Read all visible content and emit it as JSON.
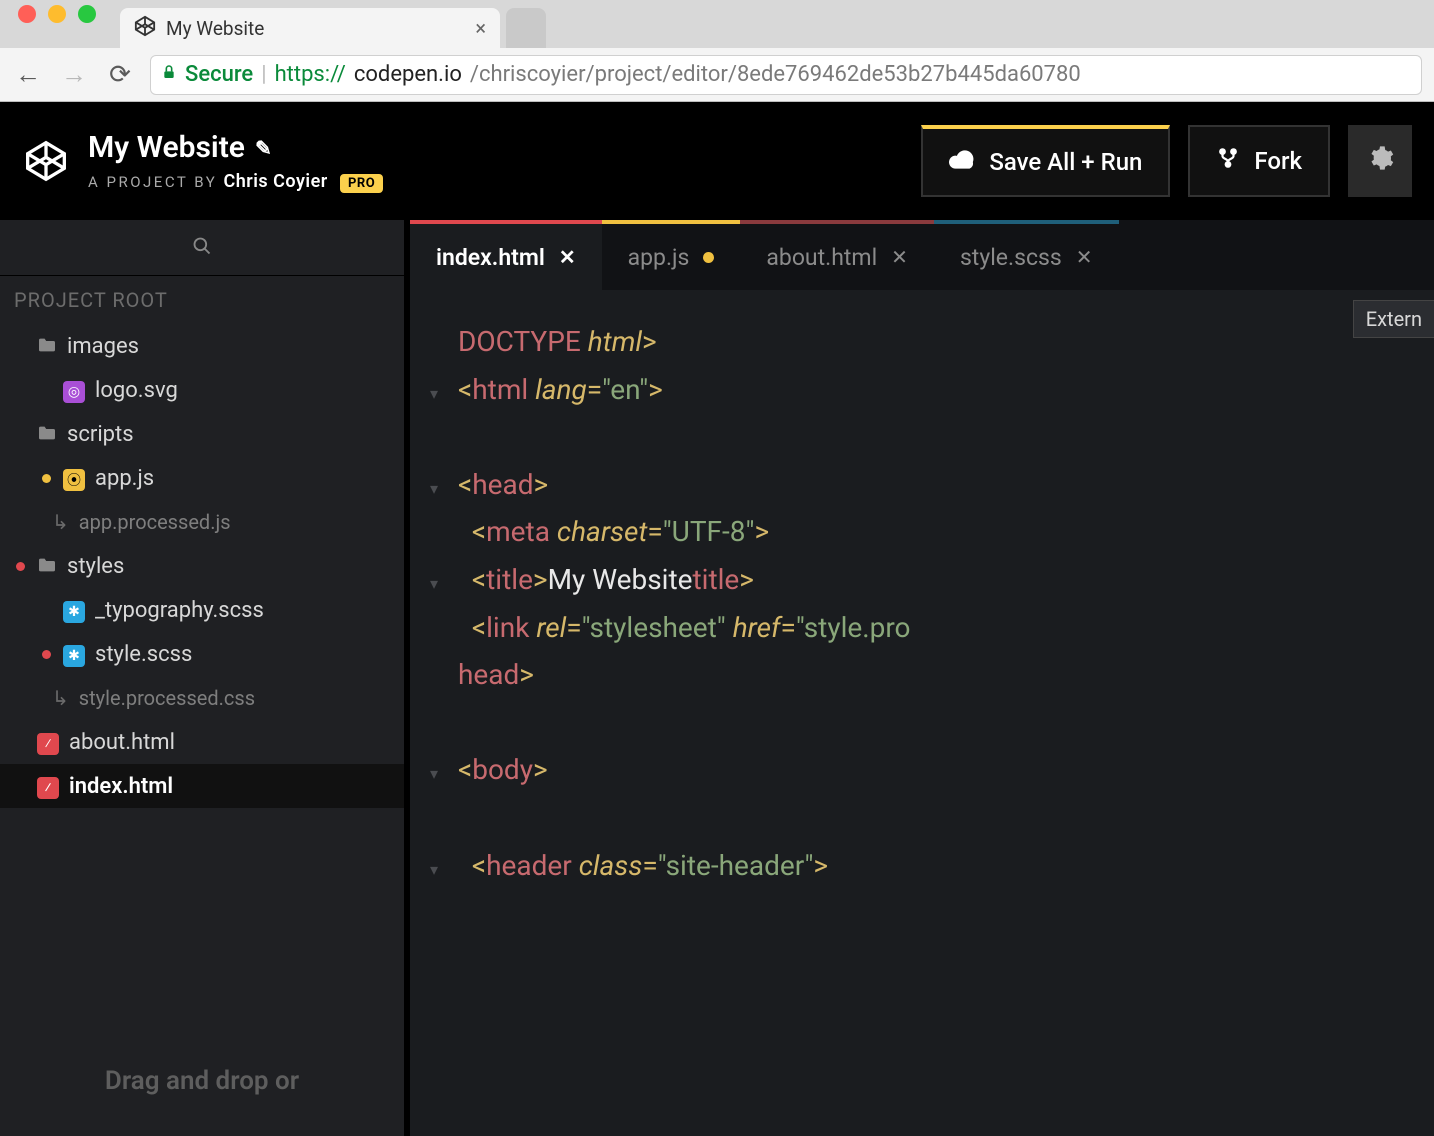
{
  "browser": {
    "tab_title": "My Website",
    "secure_label": "Secure",
    "url_proto": "https://",
    "url_host": "codepen.io",
    "url_path": "/chriscoyier/project/editor/8ede769462de53b27b445da60780"
  },
  "header": {
    "title": "My Website",
    "subtitle_prefix": "A PROJECT BY",
    "author": "Chris Coyier",
    "pro_badge": "PRO",
    "save_label": "Save All + Run",
    "fork_label": "Fork"
  },
  "sidebar": {
    "root_label": "PROJECT ROOT",
    "drop_hint": "Drag and drop or",
    "items": [
      {
        "name": "images",
        "type": "folder",
        "modified": false
      },
      {
        "name": "logo.svg",
        "type": "svg",
        "depth": 1,
        "modified": false
      },
      {
        "name": "scripts",
        "type": "folder",
        "modified": false
      },
      {
        "name": "app.js",
        "type": "js",
        "depth": 1,
        "modified": true,
        "dot": "yellow"
      },
      {
        "name": "app.processed.js",
        "type": "processed",
        "depth": 2
      },
      {
        "name": "styles",
        "type": "folder",
        "modified": true,
        "dot": "red"
      },
      {
        "name": "_typography.scss",
        "type": "scss",
        "depth": 1,
        "modified": false
      },
      {
        "name": "style.scss",
        "type": "scss",
        "depth": 1,
        "modified": true,
        "dot": "red"
      },
      {
        "name": "style.processed.css",
        "type": "processed",
        "depth": 2
      },
      {
        "name": "about.html",
        "type": "html",
        "modified": false
      },
      {
        "name": "index.html",
        "type": "html",
        "modified": false,
        "selected": true
      }
    ]
  },
  "editor_tabs": [
    {
      "label": "index.html",
      "active": true,
      "indicator": "close",
      "accent": "red"
    },
    {
      "label": "app.js",
      "active": false,
      "indicator": "dot",
      "accent": "yellow"
    },
    {
      "label": "about.html",
      "active": false,
      "indicator": "close",
      "accent": "red"
    },
    {
      "label": "style.scss",
      "active": false,
      "indicator": "close",
      "accent": "blue"
    }
  ],
  "external_button": "Extern",
  "code_lines": [
    {
      "fold": false,
      "tokens": [
        {
          "t": "bracket",
          "v": "<!"
        },
        {
          "t": "tag",
          "v": "DOCTYPE "
        },
        {
          "t": "attr",
          "v": "html"
        },
        {
          "t": "bracket",
          "v": ">"
        }
      ]
    },
    {
      "fold": true,
      "tokens": [
        {
          "t": "bracket",
          "v": "<"
        },
        {
          "t": "tag",
          "v": "html "
        },
        {
          "t": "attr",
          "v": "lang"
        },
        {
          "t": "eq",
          "v": "="
        },
        {
          "t": "str",
          "v": "\"en\""
        },
        {
          "t": "bracket",
          "v": ">"
        }
      ]
    },
    {
      "fold": false,
      "tokens": []
    },
    {
      "fold": true,
      "tokens": [
        {
          "t": "bracket",
          "v": "<"
        },
        {
          "t": "tag",
          "v": "head"
        },
        {
          "t": "bracket",
          "v": ">"
        }
      ]
    },
    {
      "fold": false,
      "tokens": [
        {
          "t": "plain",
          "v": "  "
        },
        {
          "t": "bracket",
          "v": "<"
        },
        {
          "t": "tag",
          "v": "meta "
        },
        {
          "t": "attr",
          "v": "charset"
        },
        {
          "t": "eq",
          "v": "="
        },
        {
          "t": "str",
          "v": "\"UTF-8\""
        },
        {
          "t": "bracket",
          "v": ">"
        }
      ]
    },
    {
      "fold": true,
      "tokens": [
        {
          "t": "plain",
          "v": "  "
        },
        {
          "t": "bracket",
          "v": "<"
        },
        {
          "t": "tag",
          "v": "title"
        },
        {
          "t": "bracket",
          "v": ">"
        },
        {
          "t": "text",
          "v": "My Website"
        },
        {
          "t": "bracket",
          "v": "</"
        },
        {
          "t": "tag",
          "v": "title"
        },
        {
          "t": "bracket",
          "v": ">"
        }
      ]
    },
    {
      "fold": false,
      "tokens": [
        {
          "t": "plain",
          "v": "  "
        },
        {
          "t": "bracket",
          "v": "<"
        },
        {
          "t": "tag",
          "v": "link "
        },
        {
          "t": "attr",
          "v": "rel"
        },
        {
          "t": "eq",
          "v": "="
        },
        {
          "t": "str",
          "v": "\"stylesheet\" "
        },
        {
          "t": "attr",
          "v": "href"
        },
        {
          "t": "eq",
          "v": "="
        },
        {
          "t": "str",
          "v": "\"style.pro"
        }
      ]
    },
    {
      "fold": false,
      "tokens": [
        {
          "t": "bracket",
          "v": "</"
        },
        {
          "t": "tag",
          "v": "head"
        },
        {
          "t": "bracket",
          "v": ">"
        }
      ]
    },
    {
      "fold": false,
      "tokens": []
    },
    {
      "fold": true,
      "tokens": [
        {
          "t": "bracket",
          "v": "<"
        },
        {
          "t": "tag",
          "v": "body"
        },
        {
          "t": "bracket",
          "v": ">"
        }
      ]
    },
    {
      "fold": false,
      "tokens": []
    },
    {
      "fold": true,
      "tokens": [
        {
          "t": "plain",
          "v": "  "
        },
        {
          "t": "bracket",
          "v": "<"
        },
        {
          "t": "tag",
          "v": "header "
        },
        {
          "t": "attr",
          "v": "class"
        },
        {
          "t": "eq",
          "v": "="
        },
        {
          "t": "str",
          "v": "\"site-header\""
        },
        {
          "t": "bracket",
          "v": ">"
        }
      ]
    }
  ]
}
